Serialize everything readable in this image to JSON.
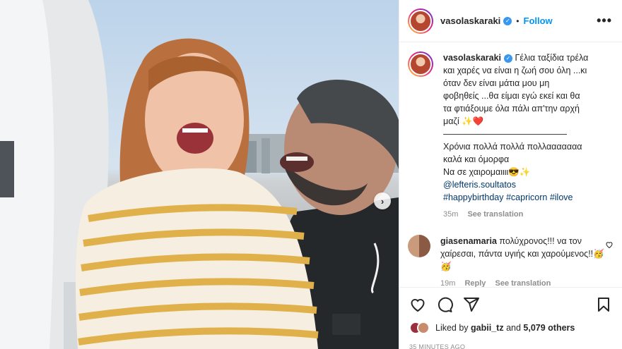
{
  "post": {
    "username": "vasolaskaraki",
    "follow_label": "Follow",
    "dot": "•",
    "more_label": "•••"
  },
  "caption": {
    "lines": [
      "Γέλια ταξίδια τρέλα",
      "και χαρές να είναι η ζωή σου όλη ...κι",
      "όταν δεν είναι μάτια μου μη",
      "φοβηθείς ...θα είμαι εγώ εκεί και θα",
      "τα φτιάξουμε όλα πάλι απ'την αρχή",
      "μαζί ✨❤️",
      "——————————————",
      "Χρόνια πολλά πολλά πολλααααααα",
      "καλά και όμορφα",
      "Να σε χαιρομαιιιι😎✨"
    ],
    "mention": "@lefteris.soultatos",
    "hashtags": [
      "#happybirthday",
      "#capricorn",
      "#ilove"
    ],
    "time": "35m",
    "see_translation": "See translation"
  },
  "comment": {
    "username": "giasenamaria",
    "text": "πολύχρονος!!! να τον χαίρεσαι, πάντα υγιής και χαρούμενος!!🥳🥳",
    "time": "19m",
    "reply": "Reply",
    "see_translation": "See translation"
  },
  "likes": {
    "prefix": "Liked by",
    "user": "gabii_tz",
    "middle": "and",
    "count": "5,079 others"
  },
  "time_ago": "35 MINUTES AGO",
  "carousel_next": "›",
  "colors": {
    "accent": "#0095f6",
    "verified": "#3897f0",
    "link": "#00376b",
    "muted": "#8e8e8e",
    "heart": "#ed4956"
  },
  "icons": [
    "verified-badge-icon",
    "more-options-icon",
    "heart-icon",
    "comment-icon",
    "share-icon",
    "bookmark-icon",
    "carousel-next-icon"
  ]
}
